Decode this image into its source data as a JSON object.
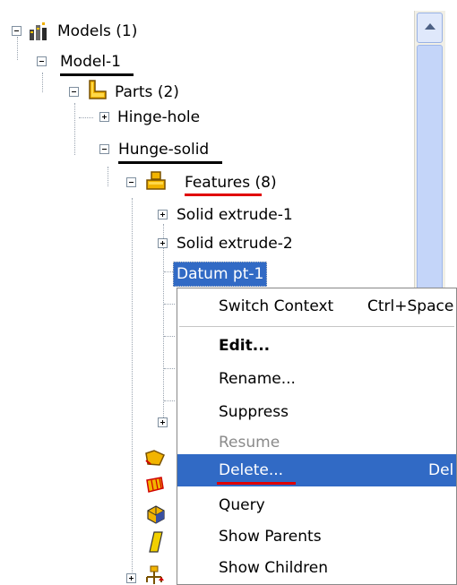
{
  "tree": {
    "models_label": "Models (1)",
    "model_label": "Model-1",
    "parts_label": "Parts (2)",
    "hinge_hole_label": "Hinge-hole",
    "hunge_solid_label": "Hunge-solid",
    "features_label": "Features",
    "features_count": "(8)",
    "solid_extrude_1_label": "Solid extrude-1",
    "solid_extrude_2_label": "Solid extrude-2",
    "datum_label": "Datum pt-1"
  },
  "context_menu": {
    "switch_context_label": "Switch Context",
    "switch_context_shortcut": "Ctrl+Space",
    "edit_label": "Edit...",
    "rename_label": "Rename...",
    "suppress_label": "Suppress",
    "resume_label": "Resume",
    "delete_label": "Delete...",
    "delete_shortcut": "Del",
    "query_label": "Query",
    "show_parents_label": "Show Parents",
    "show_children_label": "Show Children"
  },
  "colors": {
    "selection": "#316ac5",
    "annotation_red": "#e00000",
    "annotation_black": "#000000"
  }
}
